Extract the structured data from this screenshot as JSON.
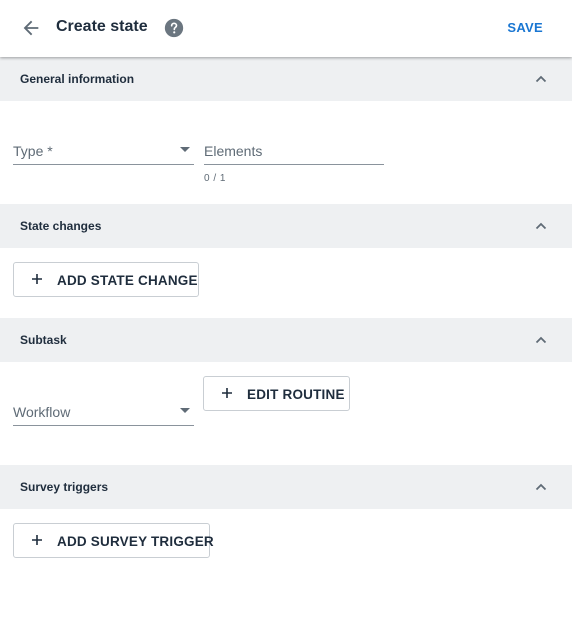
{
  "header": {
    "title": "Create state",
    "save_label": "SAVE",
    "back_icon": "arrow-left-icon",
    "help_icon": "help-circle-icon"
  },
  "sections": [
    {
      "title": "General information",
      "expanded": true
    },
    {
      "title": "State changes",
      "expanded": true
    },
    {
      "title": "Subtask",
      "expanded": true
    },
    {
      "title": "Survey triggers",
      "expanded": true
    }
  ],
  "general": {
    "type_field": {
      "label": "Type *",
      "value": ""
    },
    "elements_field": {
      "label": "Elements",
      "value": "",
      "counter": "0 / 1"
    }
  },
  "state_changes": {
    "add_button": "ADD STATE CHANGE"
  },
  "subtask": {
    "workflow_field": {
      "label": "Workflow",
      "value": ""
    },
    "edit_routine_button": "EDIT ROUTINE"
  },
  "survey_triggers": {
    "add_button": "ADD SURVEY TRIGGER"
  },
  "colors": {
    "accent": "#1976d2",
    "section_bg": "#eef0f2",
    "text": "#1f2d3d",
    "muted": "#5f6b76"
  }
}
